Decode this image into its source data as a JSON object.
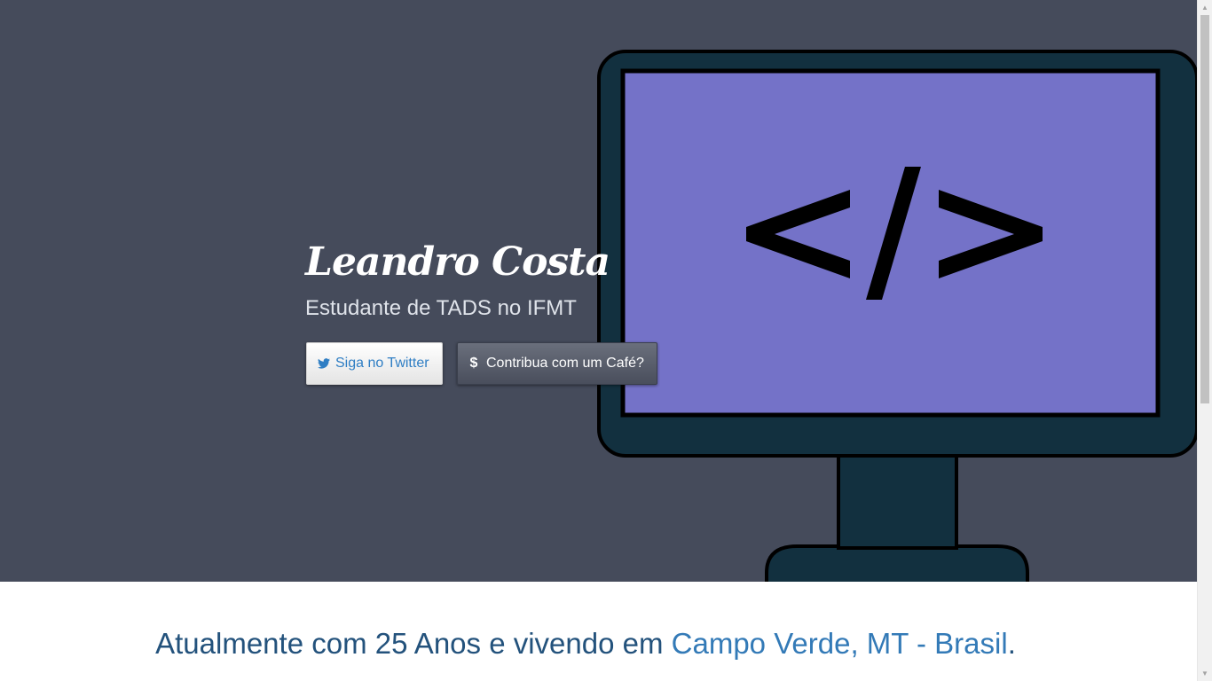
{
  "hero": {
    "name": "Leandro Costa",
    "subtitle": "Estudante de TADS no IFMT",
    "monitor_code": "</>",
    "buttons": {
      "twitter_label": "Siga no Twitter",
      "twitter_icon": "twitter-bird-icon",
      "cafe_label": "Contribua com um Café?",
      "cafe_icon": "dollar-icon",
      "cafe_symbol": "$"
    }
  },
  "about": {
    "prefix": "Atualmente com ",
    "age": "25 Anos",
    "middle": " e vivendo em ",
    "location": "Campo Verde, MT - Brasil",
    "suffix": "."
  },
  "colors": {
    "hero_bg": "#454b5b",
    "monitor_body": "#12303f",
    "monitor_screen": "#7472c8",
    "link_blue": "#337ab7",
    "text_dark_blue": "#23527c"
  }
}
